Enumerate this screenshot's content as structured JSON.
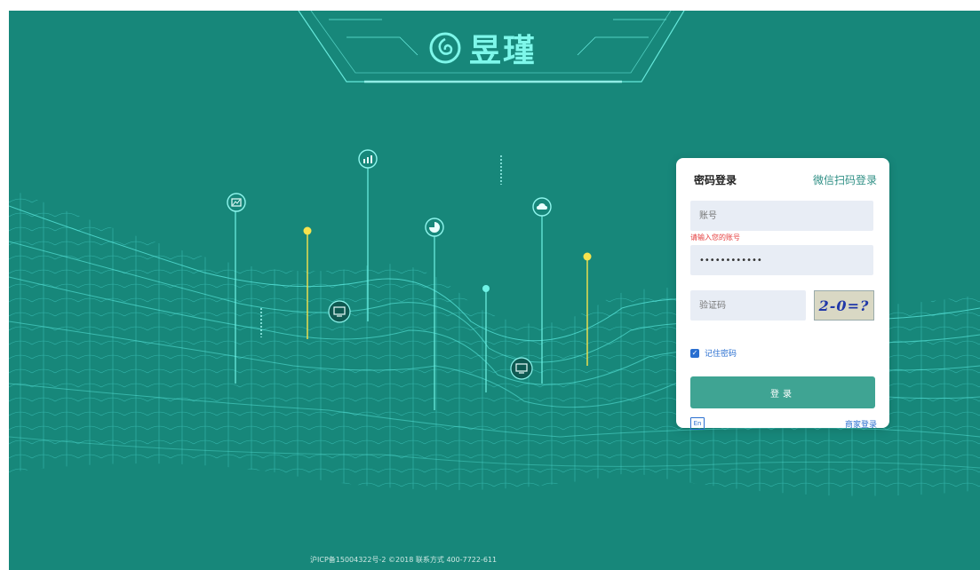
{
  "brand": {
    "name": "昱瑾",
    "logo_icon": "swirl-logo-icon"
  },
  "login": {
    "tabs": {
      "password": "密码登录",
      "wechat": "微信扫码登录"
    },
    "account_placeholder": "账号",
    "account_error": "请输入您的账号",
    "password_value": "••••••••••••",
    "captcha_placeholder": "验证码",
    "captcha_text": "2-0=?",
    "remember_label": "记住密码",
    "remember_checked": true,
    "submit_label": "登录",
    "lang_label": "En",
    "merchant_label": "商家登录"
  },
  "footer": {
    "text": "沪ICP备15004322号-2 ©2018 联系方式 400-7722-611"
  },
  "colors": {
    "background": "#17877a",
    "accent": "#3fa493",
    "link": "#2a6fd0",
    "error": "#e43a3a"
  },
  "floating_icons": [
    "image-chart-icon",
    "bar-chart-icon",
    "pie-chart-icon",
    "cloud-icon",
    "monitor-icon",
    "monitor-icon"
  ]
}
